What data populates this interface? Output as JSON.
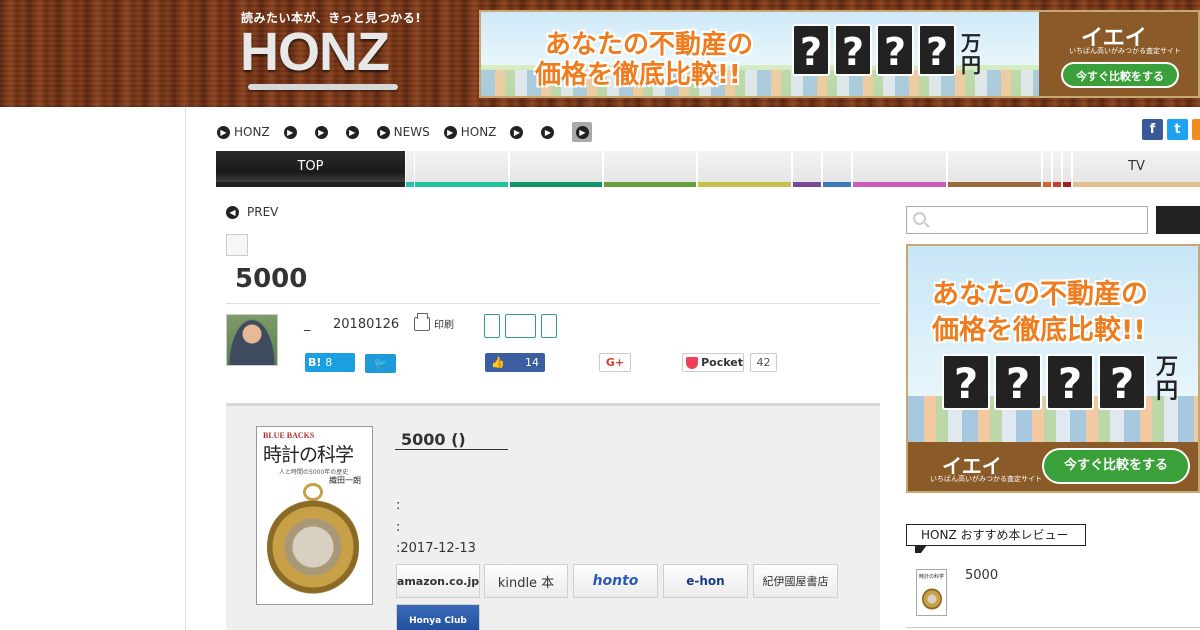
{
  "header": {
    "tagline": "読みたい本が、きっと見つかる!",
    "logo": "HONZ"
  },
  "ads": {
    "line1": "あなたの不動産の",
    "line2": "価格を徹底比較!!",
    "unknown_digits": [
      "?",
      "?",
      "?",
      "?"
    ],
    "unit": "万円",
    "brand_name": "イエイ",
    "brand_sub": "いちばん高いがみつかる査定サイト",
    "cta": "今すぐ比較をする"
  },
  "breadcrumb": {
    "items": [
      {
        "label": "HONZ"
      },
      {
        "label": ""
      },
      {
        "label": ""
      },
      {
        "label": ""
      },
      {
        "label": "NEWS"
      },
      {
        "label": "HONZ"
      },
      {
        "label": ""
      },
      {
        "label": ""
      }
    ]
  },
  "social": {
    "facebook_glyph": "f",
    "twitter_glyph": "t",
    "colors": {
      "facebook": "#3b5998",
      "twitter": "#1da1f2",
      "feed": "#f08c1e"
    }
  },
  "nav": {
    "items": [
      {
        "label": "TOP",
        "color": "#222222"
      },
      {
        "label": "",
        "color": "#2bbfae"
      },
      {
        "label": "",
        "color": "#22c3a0"
      },
      {
        "label": "",
        "color": "#12946a"
      },
      {
        "label": "",
        "color": "#6a9e3a"
      },
      {
        "label": "",
        "color": "#c8c04a"
      },
      {
        "label": "",
        "color": "#7a4a9a"
      },
      {
        "label": "",
        "color": "#3a7ab8"
      },
      {
        "label": "",
        "color": "#cc5cb8"
      },
      {
        "label": "",
        "color": "#9a6a3a"
      },
      {
        "label": "",
        "color": "#d8622a"
      },
      {
        "label": "",
        "color": "#c8402a"
      },
      {
        "label": "",
        "color": "#a02020"
      },
      {
        "label": "TV",
        "color": "#e0c090"
      }
    ]
  },
  "article": {
    "prev_label": "PREV",
    "title": "5000",
    "author": "_",
    "date": "20180126",
    "print_label": "印刷",
    "share": {
      "hatena_label": "B!",
      "hatena_count": "8",
      "facebook_count": "14",
      "google_label": "G+",
      "pocket_label": "Pocket",
      "pocket_count": "42"
    }
  },
  "book": {
    "cover": {
      "series": "BLUE BACKS",
      "title": "時計の科学",
      "subtitle": "人と時間の5000年の歴史",
      "author": "織田一朗"
    },
    "title": "5000 ()",
    "meta": [
      ":",
      ":",
      ":2017-12-13"
    ],
    "stores": [
      {
        "label": "amazon.co.jp"
      },
      {
        "label": "kindle 本"
      },
      {
        "label": "honto"
      },
      {
        "label": "e-hon"
      },
      {
        "label": "紀伊國屋書店"
      },
      {
        "label": "Honya Club"
      }
    ]
  },
  "sidebar": {
    "search_placeholder": "",
    "recommend_heading": "HONZ おすすめ本レビュー",
    "recommend_item": {
      "title": "5000",
      "thumb_title": "時計の科学"
    }
  }
}
